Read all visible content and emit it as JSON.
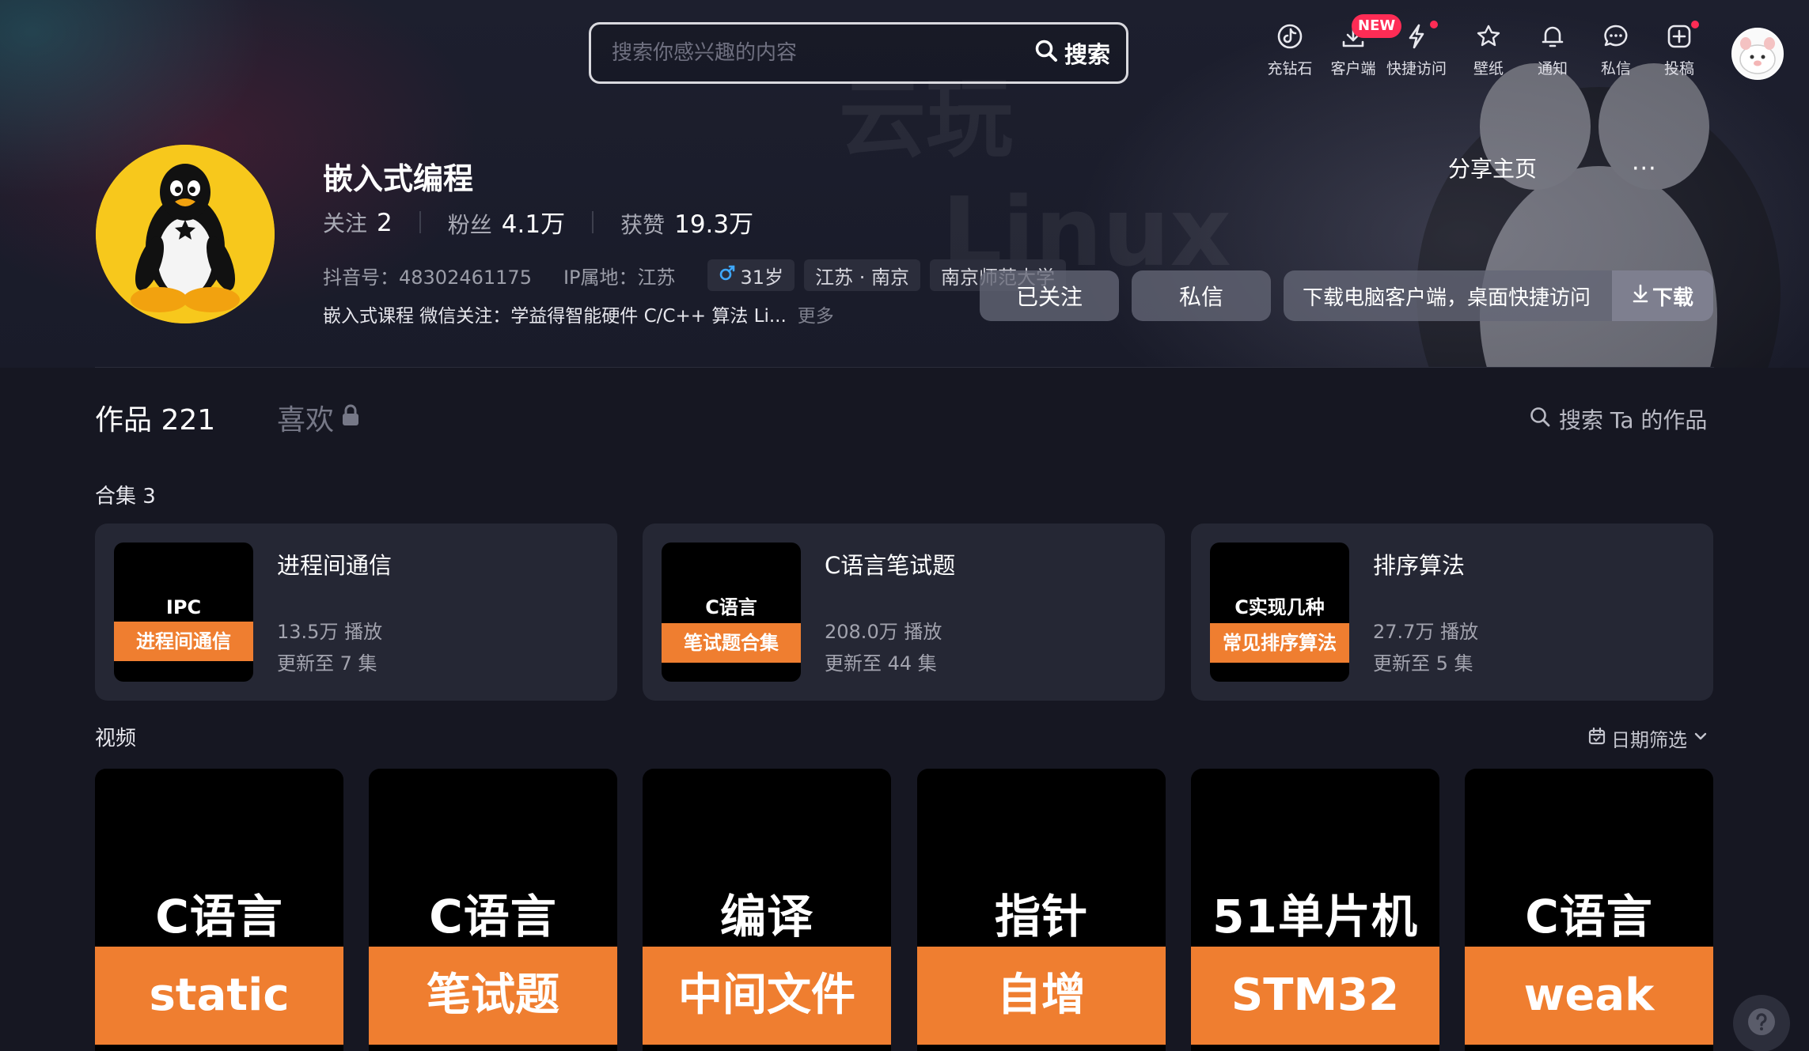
{
  "search": {
    "placeholder": "搜索你感兴趣的内容",
    "button_label": "搜索"
  },
  "topnav": {
    "items": [
      {
        "label": "充钻石",
        "icon": "tiktok-coin-icon"
      },
      {
        "label": "客户端",
        "icon": "download-icon",
        "badge": "NEW"
      },
      {
        "label": "快捷访问",
        "icon": "lightning-icon"
      },
      {
        "label": "壁纸",
        "icon": "wallpaper-icon"
      },
      {
        "label": "通知",
        "icon": "bell-icon"
      },
      {
        "label": "私信",
        "icon": "chat-icon"
      },
      {
        "label": "投稿",
        "icon": "upload-plus-icon"
      }
    ],
    "accent": "#fe2c55"
  },
  "hero_watermark": {
    "line1": "云玩",
    "line2": "Linux"
  },
  "profile": {
    "name": "嵌入式编程",
    "follow_label": "关注",
    "follow_count": "2",
    "fans_label": "粉丝",
    "fans_count": "4.1万",
    "likes_label": "获赞",
    "likes_count": "19.3万",
    "douyin_id": "抖音号：48302461175",
    "ip": "IP属地：江苏",
    "age_tag": "31岁",
    "location_tag": "江苏 · 南京",
    "school_tag": "南京师范大学",
    "bio": "嵌入式课程 微信关注：学益得智能硬件 C/C++ 算法 Li...",
    "bio_more": "更多",
    "share_label": "分享主页",
    "more_label": "···",
    "followed_label": "已关注",
    "message_label": "私信",
    "download_text": "下载电脑客户端，桌面快捷访问",
    "download_btn": "下载"
  },
  "tabs": {
    "works_label": "作品 221",
    "likes_label": "喜欢",
    "search_works": "搜索 Ta 的作品"
  },
  "collections": {
    "title": "合集 3",
    "items": [
      {
        "cover_top": "IPC",
        "cover_bottom": "进程间通信",
        "title": "进程间通信",
        "plays": "13.5万 播放",
        "updated": "更新至 7 集"
      },
      {
        "cover_top": "C语言",
        "cover_bottom": "笔试题合集",
        "title": "C语言笔试题",
        "plays": "208.0万 播放",
        "updated": "更新至 44 集"
      },
      {
        "cover_top": "C实现几种",
        "cover_bottom": "常见排序算法",
        "title": "排序算法",
        "plays": "27.7万 播放",
        "updated": "更新至 5 集"
      }
    ]
  },
  "videos": {
    "title": "视频",
    "date_filter": "日期筛选",
    "items": [
      {
        "top": "C语言",
        "bottom": "static"
      },
      {
        "top": "C语言",
        "bottom": "笔试题"
      },
      {
        "top": "编译",
        "bottom": "中间文件"
      },
      {
        "top": "指针",
        "bottom": "自增"
      },
      {
        "top": "51单片机",
        "bottom": "STM32"
      },
      {
        "top": "C语言",
        "bottom": "weak"
      }
    ],
    "cover_accent": "#ef7e30"
  }
}
